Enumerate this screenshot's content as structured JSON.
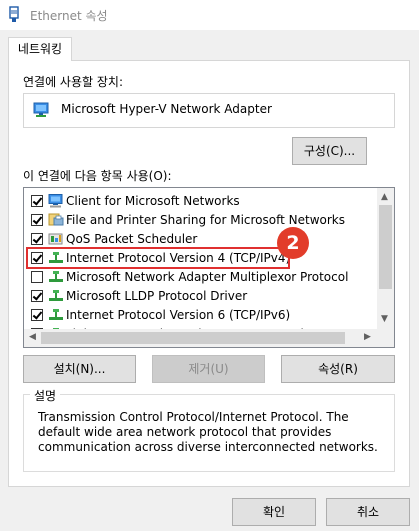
{
  "window": {
    "title": "Ethernet 속성"
  },
  "tabs": [
    {
      "label": "네트워킹"
    }
  ],
  "connect_using": {
    "label": "연결에 사용할 장치:",
    "adapter": "Microsoft Hyper-V Network Adapter",
    "configure_label": "구성(C)..."
  },
  "items_section": {
    "label": "이 연결에 다음 항목 사용(O):",
    "items": [
      {
        "label": "Client for Microsoft Networks",
        "checked": true,
        "icon": "network-client-icon"
      },
      {
        "label": "File and Printer Sharing for Microsoft Networks",
        "checked": true,
        "icon": "file-printer-sharing-icon"
      },
      {
        "label": "QoS Packet Scheduler",
        "checked": true,
        "icon": "qos-scheduler-icon"
      },
      {
        "label": "Internet Protocol Version 4 (TCP/IPv4)",
        "checked": true,
        "icon": "protocol-icon"
      },
      {
        "label": "Microsoft Network Adapter Multiplexor Protocol",
        "checked": false,
        "icon": "protocol-icon"
      },
      {
        "label": "Microsoft LLDP Protocol Driver",
        "checked": true,
        "icon": "protocol-icon"
      },
      {
        "label": "Internet Protocol Version 6 (TCP/IPv6)",
        "checked": true,
        "icon": "protocol-icon"
      },
      {
        "label": "Link-Layer Topology Discovery Responder",
        "checked": true,
        "icon": "protocol-icon"
      }
    ],
    "annotation_badge": "2"
  },
  "buttons": {
    "install": "설치(N)...",
    "uninstall": "제거(U)",
    "properties": "속성(R)",
    "ok": "확인",
    "cancel": "취소"
  },
  "description": {
    "legend": "설명",
    "text": "Transmission Control Protocol/Internet Protocol. The default wide area network protocol that provides communication across diverse interconnected networks."
  },
  "colors": {
    "highlight_border": "#e03030",
    "badge": "#e23c2a",
    "protocol_icon": "#2e9a3c"
  }
}
